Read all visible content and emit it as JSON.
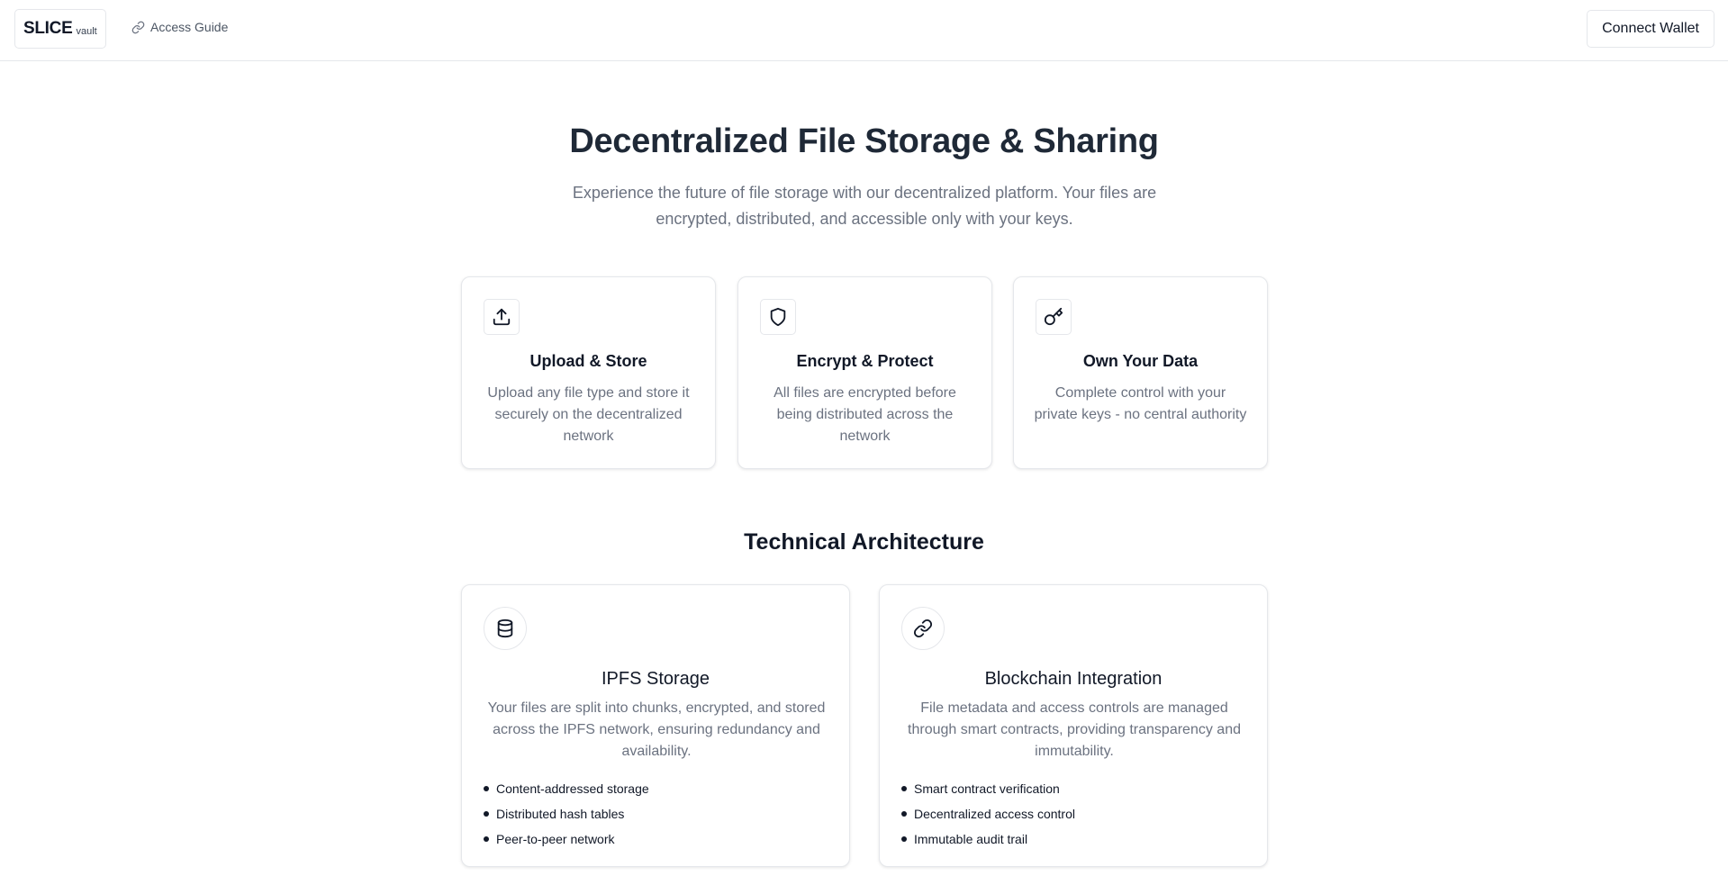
{
  "header": {
    "logo_main": "SLICE",
    "logo_sub": "vault",
    "access_guide_label": "Access Guide",
    "connect_wallet_label": "Connect Wallet"
  },
  "hero": {
    "title": "Decentralized File Storage & Sharing",
    "description": "Experience the future of file storage with our decentralized platform. Your files are encrypted, distributed, and accessible only with your keys."
  },
  "features": [
    {
      "icon": "upload-icon",
      "title": "Upload & Store",
      "description": "Upload any file type and store it securely on the decentralized network"
    },
    {
      "icon": "shield-icon",
      "title": "Encrypt & Protect",
      "description": "All files are encrypted before being distributed across the network"
    },
    {
      "icon": "key-icon",
      "title": "Own Your Data",
      "description": "Complete control with your private keys - no central authority"
    }
  ],
  "architecture": {
    "title": "Technical Architecture",
    "cards": [
      {
        "icon": "database-icon",
        "title": "IPFS Storage",
        "description": "Your files are split into chunks, encrypted, and stored across the IPFS network, ensuring redundancy and availability.",
        "bullets": [
          "Content-addressed storage",
          "Distributed hash tables",
          "Peer-to-peer network"
        ]
      },
      {
        "icon": "link-icon",
        "title": "Blockchain Integration",
        "description": "File metadata and access controls are managed through smart contracts, providing transparency and immutability.",
        "bullets": [
          "Smart contract verification",
          "Decentralized access control",
          "Immutable audit trail"
        ]
      }
    ]
  }
}
